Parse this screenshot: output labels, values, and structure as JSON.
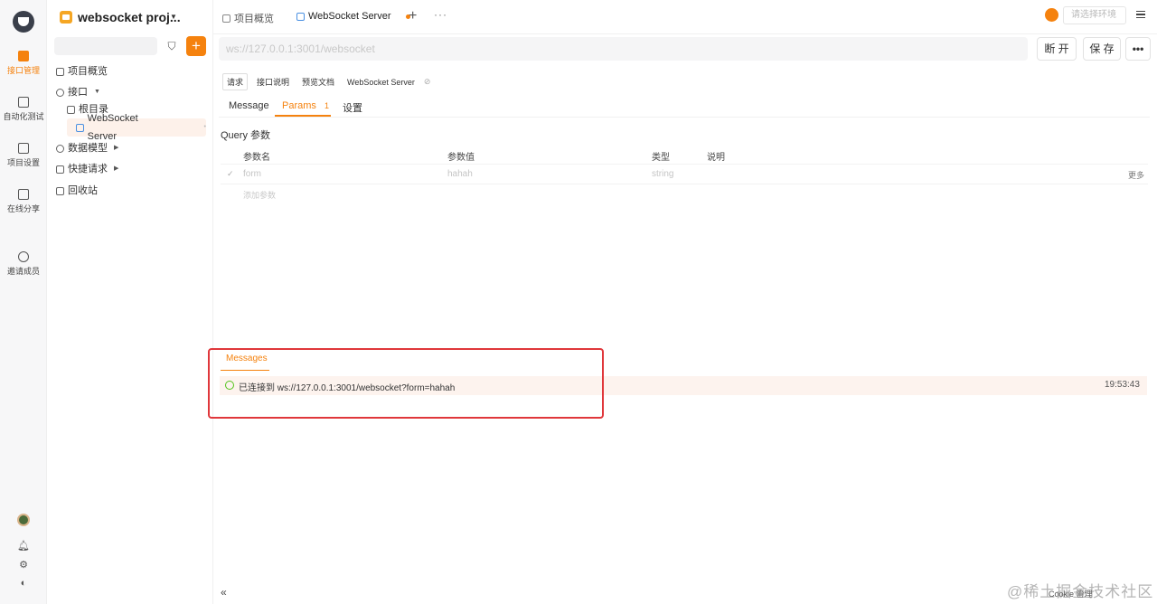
{
  "rail": {
    "items": [
      {
        "label": "接口管理",
        "icon": "api-icon"
      },
      {
        "label": "自动化测试",
        "icon": "test-icon"
      },
      {
        "label": "项目设置",
        "icon": "settings-icon"
      },
      {
        "label": "在线分享",
        "icon": "share-icon"
      },
      {
        "label": "邀请成员",
        "icon": "user-icon"
      }
    ],
    "bottom_icons": [
      "bell-icon",
      "gear-icon",
      "palette-icon"
    ]
  },
  "sidebar": {
    "project_name": "websocket proj...",
    "search_placeholder": "",
    "tree": [
      {
        "label": "项目概览",
        "icon": "overview-icon"
      },
      {
        "label": "接口",
        "icon": "api-icon"
      },
      {
        "label": "根目录",
        "icon": "folder-icon"
      },
      {
        "label": "WebSocket Server",
        "icon": "websocket-icon"
      },
      {
        "label": "数据模型",
        "icon": "model-icon"
      },
      {
        "label": "快捷请求",
        "icon": "request-icon"
      },
      {
        "label": "回收站",
        "icon": "trash-icon"
      }
    ]
  },
  "tabs": [
    {
      "label": "项目概览"
    },
    {
      "label": "WebSocket Server"
    }
  ],
  "env": {
    "placeholder": "请选择环境"
  },
  "url": {
    "value": "ws://127.0.0.1:3001/websocket"
  },
  "actions": {
    "disconnect": "断 开",
    "save": "保 存",
    "more": "•••"
  },
  "sub_tabs": [
    "请求",
    "接口说明",
    "预览文档",
    "WebSocket Server"
  ],
  "req_tabs": [
    {
      "label": "Message"
    },
    {
      "label": "Params",
      "badge": "1"
    },
    {
      "label": "设置"
    }
  ],
  "query": {
    "title": "Query 参数",
    "headers": [
      "参数名",
      "参数值",
      "类型",
      "说明"
    ],
    "rows": [
      {
        "name": "form",
        "value": "hahah",
        "type": "string",
        "more": "更多"
      }
    ],
    "add_label": "添加参数"
  },
  "messages": {
    "tab_label": "Messages",
    "items": [
      {
        "text": "已连接到 ws://127.0.0.1:3001/websocket?form=hahah",
        "time": "19:53:43"
      }
    ]
  },
  "footer": {
    "collapse": "«",
    "cookie": "Cookie 管理"
  },
  "watermark": "@稀土掘金技术社区",
  "colors": {
    "accent": "#f5820e",
    "highlight": "#e0373b",
    "success": "#52c41a"
  }
}
